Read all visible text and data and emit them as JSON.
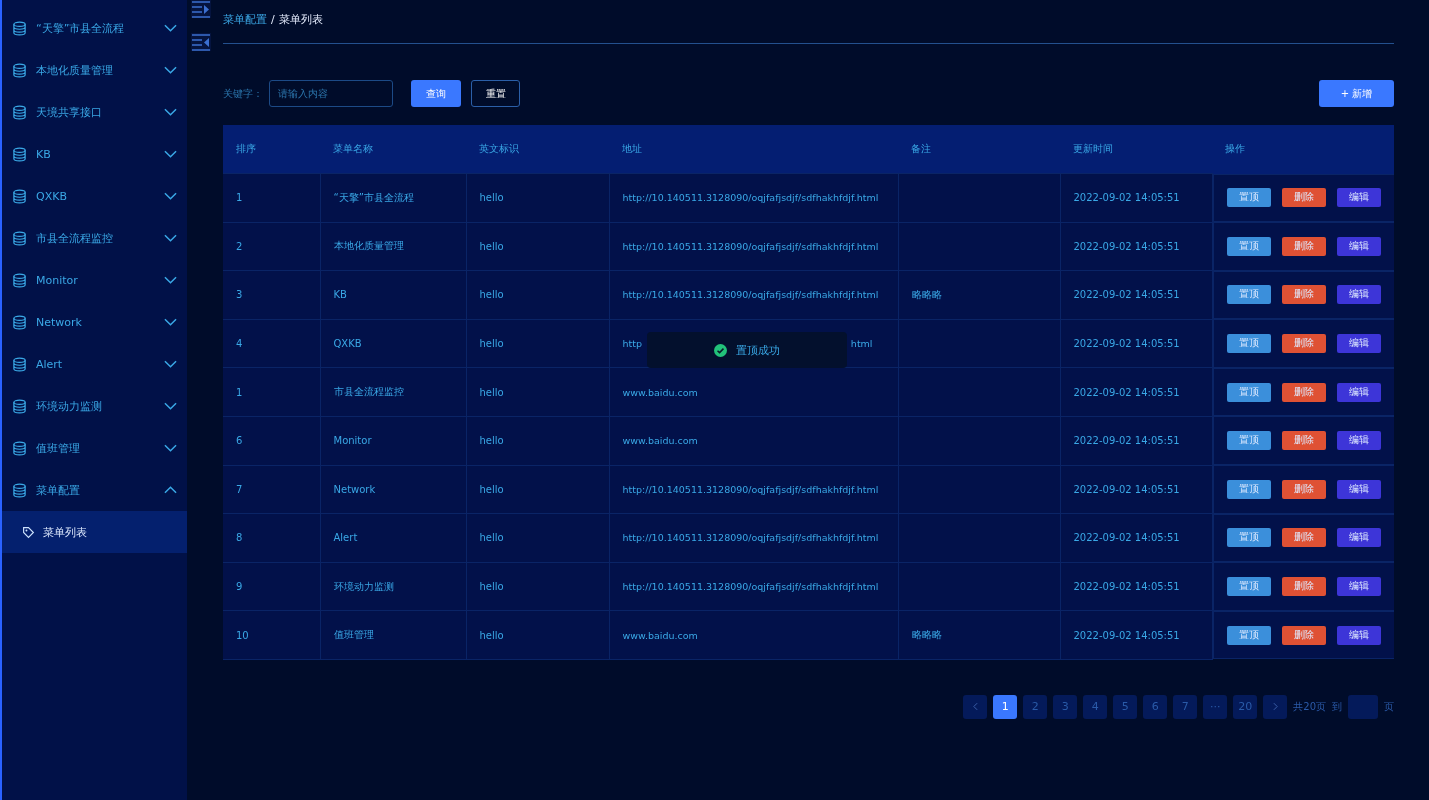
{
  "sidebar": {
    "items": [
      {
        "label": "“天擎”市县全流程",
        "expanded": false
      },
      {
        "label": "本地化质量管理",
        "expanded": false
      },
      {
        "label": "天境共享接口",
        "expanded": false
      },
      {
        "label": "KB",
        "expanded": false
      },
      {
        "label": "QXKB",
        "expanded": false
      },
      {
        "label": "市县全流程监控",
        "expanded": false
      },
      {
        "label": "Monitor",
        "expanded": false
      },
      {
        "label": "Network",
        "expanded": false
      },
      {
        "label": "Alert",
        "expanded": false
      },
      {
        "label": "环境动力监测",
        "expanded": false
      },
      {
        "label": "值班管理",
        "expanded": false
      },
      {
        "label": "菜单配置",
        "expanded": true,
        "children": [
          {
            "label": "菜单列表",
            "selected": true
          }
        ]
      }
    ]
  },
  "breadcrumb": {
    "parent": "菜单配置",
    "separator": "/",
    "current": "菜单列表"
  },
  "filter": {
    "label": "关键字：",
    "placeholder": "请输入内容",
    "search_button": "查询",
    "reset_button": "重置",
    "add_button": "+ 新增"
  },
  "table": {
    "columns": [
      "排序",
      "菜单名称",
      "英文标识",
      "地址",
      "备注",
      "更新时间",
      "操作"
    ],
    "rows": [
      {
        "order": "1",
        "name": "“天擎”市县全流程",
        "code": "hello",
        "address": "http://10.140511.3128090/oqjfafjsdjf/sdfhakhfdjf.html",
        "note": "",
        "updated": "2022-09-02 14:05:51",
        "actions": [
          "置顶",
          "删除",
          "编辑"
        ]
      },
      {
        "order": "2",
        "name": "本地化质量管理",
        "code": "hello",
        "address": "http://10.140511.3128090/oqjfafjsdjf/sdfhakhfdjf.html",
        "note": "",
        "updated": "2022-09-02 14:05:51",
        "actions": [
          "置顶",
          "删除",
          "编辑"
        ]
      },
      {
        "order": "3",
        "name": "KB",
        "code": "hello",
        "address": "http://10.140511.3128090/oqjfafjsdjf/sdfhakhfdjf.html",
        "note": "略略略",
        "updated": "2022-09-02 14:05:51",
        "actions": [
          "置顶",
          "删除",
          "编辑"
        ]
      },
      {
        "order": "4",
        "name": "QXKB",
        "code": "hello",
        "address": "http",
        "address_end": "html",
        "note": "",
        "updated": "2022-09-02 14:05:51",
        "actions": [
          "置顶",
          "删除",
          "编辑"
        ]
      },
      {
        "order": "1",
        "name": "市县全流程监控",
        "code": "hello",
        "address": "www.baidu.com",
        "note": "",
        "updated": "2022-09-02 14:05:51",
        "actions": [
          "置顶",
          "删除",
          "编辑"
        ]
      },
      {
        "order": "6",
        "name": "Monitor",
        "code": "hello",
        "address": "www.baidu.com",
        "note": "",
        "updated": "2022-09-02 14:05:51",
        "actions": [
          "置顶",
          "删除",
          "编辑"
        ]
      },
      {
        "order": "7",
        "name": "Network",
        "code": "hello",
        "address": "http://10.140511.3128090/oqjfafjsdjf/sdfhakhfdjf.html",
        "note": "",
        "updated": "2022-09-02 14:05:51",
        "actions": [
          "置顶",
          "删除",
          "编辑"
        ]
      },
      {
        "order": "8",
        "name": "Alert",
        "code": "hello",
        "address": "http://10.140511.3128090/oqjfafjsdjf/sdfhakhfdjf.html",
        "note": "",
        "updated": "2022-09-02 14:05:51",
        "actions": [
          "置顶",
          "删除",
          "编辑"
        ]
      },
      {
        "order": "9",
        "name": "环境动力监测",
        "code": "hello",
        "address": "http://10.140511.3128090/oqjfafjsdjf/sdfhakhfdjf.html",
        "note": "",
        "updated": "2022-09-02 14:05:51",
        "actions": [
          "置顶",
          "删除",
          "编辑"
        ]
      },
      {
        "order": "10",
        "name": "值班管理",
        "code": "hello",
        "address": "www.baidu.com",
        "note": "略略略",
        "updated": "2022-09-02 14:05:51",
        "actions": [
          "置顶",
          "删除",
          "编辑"
        ]
      }
    ]
  },
  "toast": {
    "message": "置顶成功"
  },
  "pagination": {
    "pages": [
      {
        "label": "1",
        "selected": true
      },
      {
        "label": "2",
        "selected": false
      },
      {
        "label": "3",
        "selected": false
      },
      {
        "label": "4",
        "selected": false
      },
      {
        "label": "5",
        "selected": false
      },
      {
        "label": "6",
        "selected": false
      },
      {
        "label": "7",
        "selected": false
      },
      {
        "label": "···",
        "selected": false
      },
      {
        "label": "20",
        "selected": false
      }
    ],
    "total": "共20页",
    "goto": "到",
    "page_unit": "页"
  }
}
